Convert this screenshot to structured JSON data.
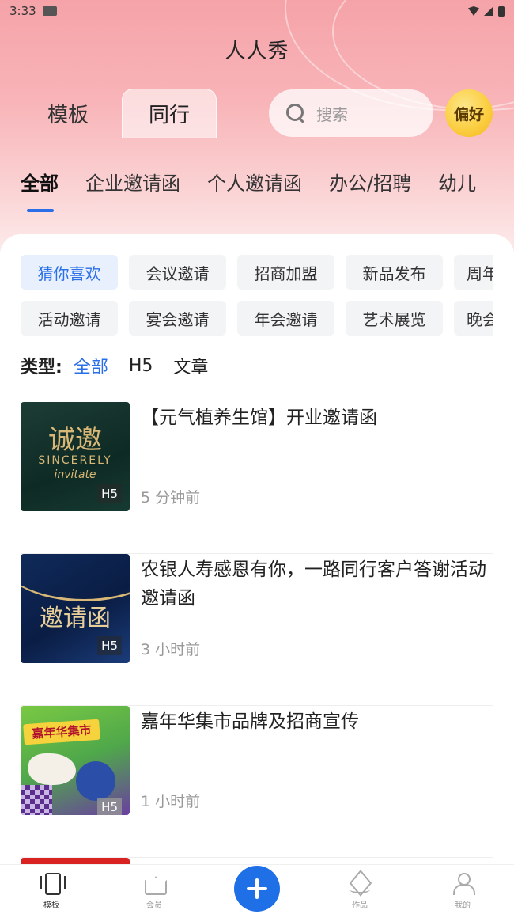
{
  "status_bar": {
    "time": "3:33"
  },
  "app": {
    "title": "人人秀"
  },
  "segment_tabs": [
    {
      "label": "模板",
      "active": false
    },
    {
      "label": "同行",
      "active": true
    }
  ],
  "search": {
    "placeholder": "搜索",
    "icon": "search-icon"
  },
  "preference_button": {
    "label": "偏好"
  },
  "category_tabs": [
    {
      "label": "全部",
      "active": true
    },
    {
      "label": "企业邀请函",
      "active": false
    },
    {
      "label": "个人邀请函",
      "active": false
    },
    {
      "label": "办公/招聘",
      "active": false
    },
    {
      "label": "幼儿",
      "active": false
    }
  ],
  "chips": {
    "row1": [
      "猜你喜欢",
      "会议邀请",
      "招商加盟",
      "新品发布",
      "周年"
    ],
    "row2": [
      "活动邀请",
      "宴会邀请",
      "年会邀请",
      "艺术展览",
      "晚会"
    ]
  },
  "type_filter": {
    "label": "类型:",
    "options": [
      "全部",
      "H5",
      "文章"
    ],
    "active": "全部"
  },
  "list": [
    {
      "title": "【元气植养生馆】开业邀请函",
      "time": "5 分钟前",
      "badge": "H5",
      "thumb_text": "诚邀",
      "thumb_sub1": "SINCERELY",
      "thumb_sub2": "invitate"
    },
    {
      "title": "农银人寿感恩有你，一路同行客户答谢活动邀请函",
      "time": "3 小时前",
      "badge": "H5",
      "thumb_text": "邀请函"
    },
    {
      "title": "嘉年华集市品牌及招商宣传",
      "time": "1 小时前",
      "badge": "H5",
      "thumb_text": "嘉年华集市"
    }
  ],
  "tabbar": [
    {
      "label": "模板",
      "icon": "template-icon",
      "active": true
    },
    {
      "label": "会员",
      "icon": "crown-icon",
      "active": false
    },
    {
      "label": "作品",
      "icon": "layers-icon",
      "active": false
    },
    {
      "label": "我的",
      "icon": "user-icon",
      "active": false
    }
  ],
  "colors": {
    "accent": "#2b6fe8",
    "add_button": "#1f6fe6",
    "preference_gold": "#fbcf43"
  }
}
